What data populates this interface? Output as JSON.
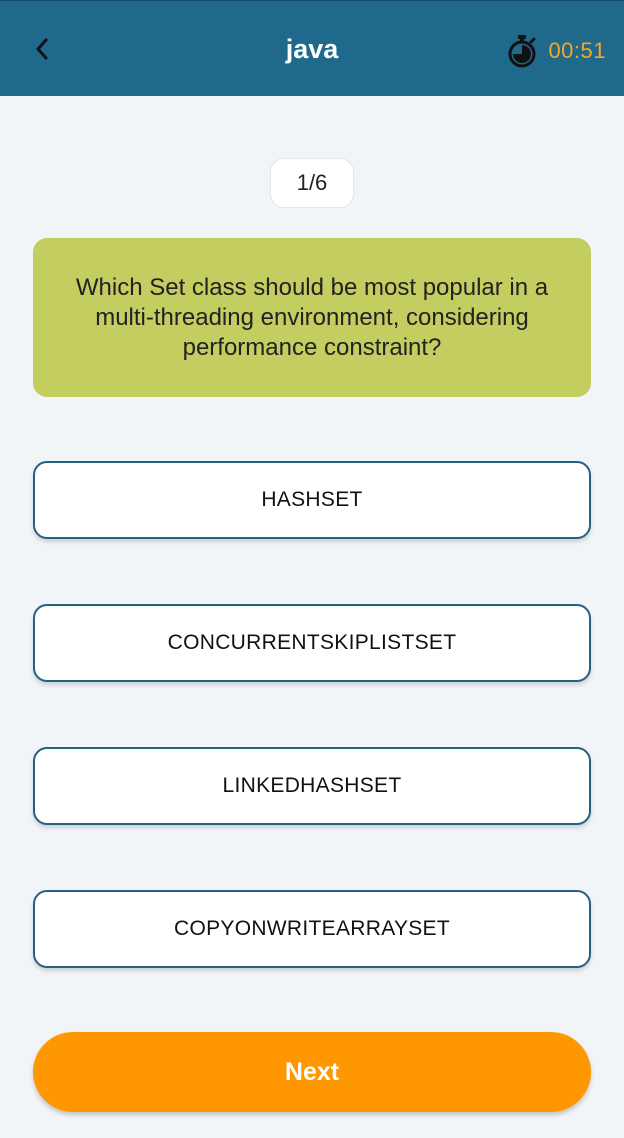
{
  "header": {
    "title": "java",
    "timer": "00:51",
    "back_icon": "chevron-left-icon",
    "timer_icon": "stopwatch-icon"
  },
  "progress": {
    "label": "1/6"
  },
  "question": {
    "text": "Which Set class should be most popular in a multi-threading environment, considering performance constraint?"
  },
  "options": [
    {
      "label": "HASHSET"
    },
    {
      "label": "CONCURRENTSKIPLISTSET"
    },
    {
      "label": "LINKEDHASHSET"
    },
    {
      "label": "COPYONWRITEARRAYSET"
    }
  ],
  "actions": {
    "next_label": "Next"
  },
  "colors": {
    "header_bg": "#1f6a8c",
    "timer_text": "#f5a623",
    "question_bg": "#c4cd5f",
    "option_border": "#24627f",
    "next_bg": "#ff9800"
  }
}
